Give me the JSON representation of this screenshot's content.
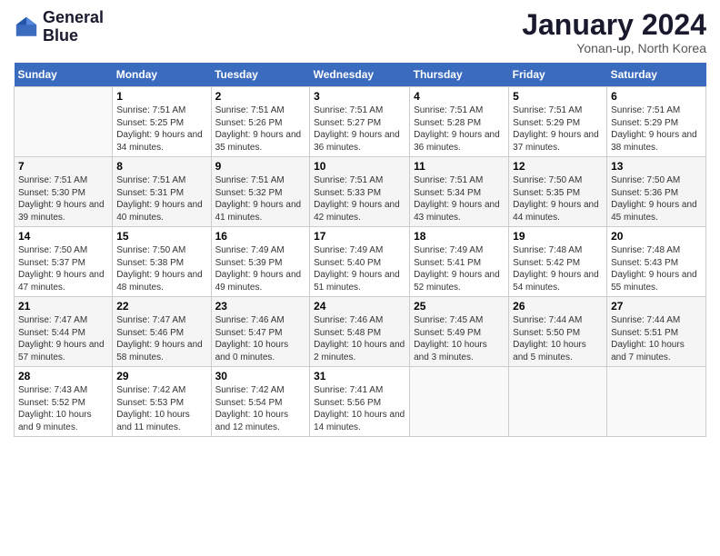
{
  "header": {
    "logo_line1": "General",
    "logo_line2": "Blue",
    "month_title": "January 2024",
    "subtitle": "Yonan-up, North Korea"
  },
  "columns": [
    "Sunday",
    "Monday",
    "Tuesday",
    "Wednesday",
    "Thursday",
    "Friday",
    "Saturday"
  ],
  "weeks": [
    [
      {
        "day": "",
        "sunrise": "",
        "sunset": "",
        "daylight": ""
      },
      {
        "day": "1",
        "sunrise": "Sunrise: 7:51 AM",
        "sunset": "Sunset: 5:25 PM",
        "daylight": "Daylight: 9 hours and 34 minutes."
      },
      {
        "day": "2",
        "sunrise": "Sunrise: 7:51 AM",
        "sunset": "Sunset: 5:26 PM",
        "daylight": "Daylight: 9 hours and 35 minutes."
      },
      {
        "day": "3",
        "sunrise": "Sunrise: 7:51 AM",
        "sunset": "Sunset: 5:27 PM",
        "daylight": "Daylight: 9 hours and 36 minutes."
      },
      {
        "day": "4",
        "sunrise": "Sunrise: 7:51 AM",
        "sunset": "Sunset: 5:28 PM",
        "daylight": "Daylight: 9 hours and 36 minutes."
      },
      {
        "day": "5",
        "sunrise": "Sunrise: 7:51 AM",
        "sunset": "Sunset: 5:29 PM",
        "daylight": "Daylight: 9 hours and 37 minutes."
      },
      {
        "day": "6",
        "sunrise": "Sunrise: 7:51 AM",
        "sunset": "Sunset: 5:29 PM",
        "daylight": "Daylight: 9 hours and 38 minutes."
      }
    ],
    [
      {
        "day": "7",
        "sunrise": "Sunrise: 7:51 AM",
        "sunset": "Sunset: 5:30 PM",
        "daylight": "Daylight: 9 hours and 39 minutes."
      },
      {
        "day": "8",
        "sunrise": "Sunrise: 7:51 AM",
        "sunset": "Sunset: 5:31 PM",
        "daylight": "Daylight: 9 hours and 40 minutes."
      },
      {
        "day": "9",
        "sunrise": "Sunrise: 7:51 AM",
        "sunset": "Sunset: 5:32 PM",
        "daylight": "Daylight: 9 hours and 41 minutes."
      },
      {
        "day": "10",
        "sunrise": "Sunrise: 7:51 AM",
        "sunset": "Sunset: 5:33 PM",
        "daylight": "Daylight: 9 hours and 42 minutes."
      },
      {
        "day": "11",
        "sunrise": "Sunrise: 7:51 AM",
        "sunset": "Sunset: 5:34 PM",
        "daylight": "Daylight: 9 hours and 43 minutes."
      },
      {
        "day": "12",
        "sunrise": "Sunrise: 7:50 AM",
        "sunset": "Sunset: 5:35 PM",
        "daylight": "Daylight: 9 hours and 44 minutes."
      },
      {
        "day": "13",
        "sunrise": "Sunrise: 7:50 AM",
        "sunset": "Sunset: 5:36 PM",
        "daylight": "Daylight: 9 hours and 45 minutes."
      }
    ],
    [
      {
        "day": "14",
        "sunrise": "Sunrise: 7:50 AM",
        "sunset": "Sunset: 5:37 PM",
        "daylight": "Daylight: 9 hours and 47 minutes."
      },
      {
        "day": "15",
        "sunrise": "Sunrise: 7:50 AM",
        "sunset": "Sunset: 5:38 PM",
        "daylight": "Daylight: 9 hours and 48 minutes."
      },
      {
        "day": "16",
        "sunrise": "Sunrise: 7:49 AM",
        "sunset": "Sunset: 5:39 PM",
        "daylight": "Daylight: 9 hours and 49 minutes."
      },
      {
        "day": "17",
        "sunrise": "Sunrise: 7:49 AM",
        "sunset": "Sunset: 5:40 PM",
        "daylight": "Daylight: 9 hours and 51 minutes."
      },
      {
        "day": "18",
        "sunrise": "Sunrise: 7:49 AM",
        "sunset": "Sunset: 5:41 PM",
        "daylight": "Daylight: 9 hours and 52 minutes."
      },
      {
        "day": "19",
        "sunrise": "Sunrise: 7:48 AM",
        "sunset": "Sunset: 5:42 PM",
        "daylight": "Daylight: 9 hours and 54 minutes."
      },
      {
        "day": "20",
        "sunrise": "Sunrise: 7:48 AM",
        "sunset": "Sunset: 5:43 PM",
        "daylight": "Daylight: 9 hours and 55 minutes."
      }
    ],
    [
      {
        "day": "21",
        "sunrise": "Sunrise: 7:47 AM",
        "sunset": "Sunset: 5:44 PM",
        "daylight": "Daylight: 9 hours and 57 minutes."
      },
      {
        "day": "22",
        "sunrise": "Sunrise: 7:47 AM",
        "sunset": "Sunset: 5:46 PM",
        "daylight": "Daylight: 9 hours and 58 minutes."
      },
      {
        "day": "23",
        "sunrise": "Sunrise: 7:46 AM",
        "sunset": "Sunset: 5:47 PM",
        "daylight": "Daylight: 10 hours and 0 minutes."
      },
      {
        "day": "24",
        "sunrise": "Sunrise: 7:46 AM",
        "sunset": "Sunset: 5:48 PM",
        "daylight": "Daylight: 10 hours and 2 minutes."
      },
      {
        "day": "25",
        "sunrise": "Sunrise: 7:45 AM",
        "sunset": "Sunset: 5:49 PM",
        "daylight": "Daylight: 10 hours and 3 minutes."
      },
      {
        "day": "26",
        "sunrise": "Sunrise: 7:44 AM",
        "sunset": "Sunset: 5:50 PM",
        "daylight": "Daylight: 10 hours and 5 minutes."
      },
      {
        "day": "27",
        "sunrise": "Sunrise: 7:44 AM",
        "sunset": "Sunset: 5:51 PM",
        "daylight": "Daylight: 10 hours and 7 minutes."
      }
    ],
    [
      {
        "day": "28",
        "sunrise": "Sunrise: 7:43 AM",
        "sunset": "Sunset: 5:52 PM",
        "daylight": "Daylight: 10 hours and 9 minutes."
      },
      {
        "day": "29",
        "sunrise": "Sunrise: 7:42 AM",
        "sunset": "Sunset: 5:53 PM",
        "daylight": "Daylight: 10 hours and 11 minutes."
      },
      {
        "day": "30",
        "sunrise": "Sunrise: 7:42 AM",
        "sunset": "Sunset: 5:54 PM",
        "daylight": "Daylight: 10 hours and 12 minutes."
      },
      {
        "day": "31",
        "sunrise": "Sunrise: 7:41 AM",
        "sunset": "Sunset: 5:56 PM",
        "daylight": "Daylight: 10 hours and 14 minutes."
      },
      {
        "day": "",
        "sunrise": "",
        "sunset": "",
        "daylight": ""
      },
      {
        "day": "",
        "sunrise": "",
        "sunset": "",
        "daylight": ""
      },
      {
        "day": "",
        "sunrise": "",
        "sunset": "",
        "daylight": ""
      }
    ]
  ]
}
